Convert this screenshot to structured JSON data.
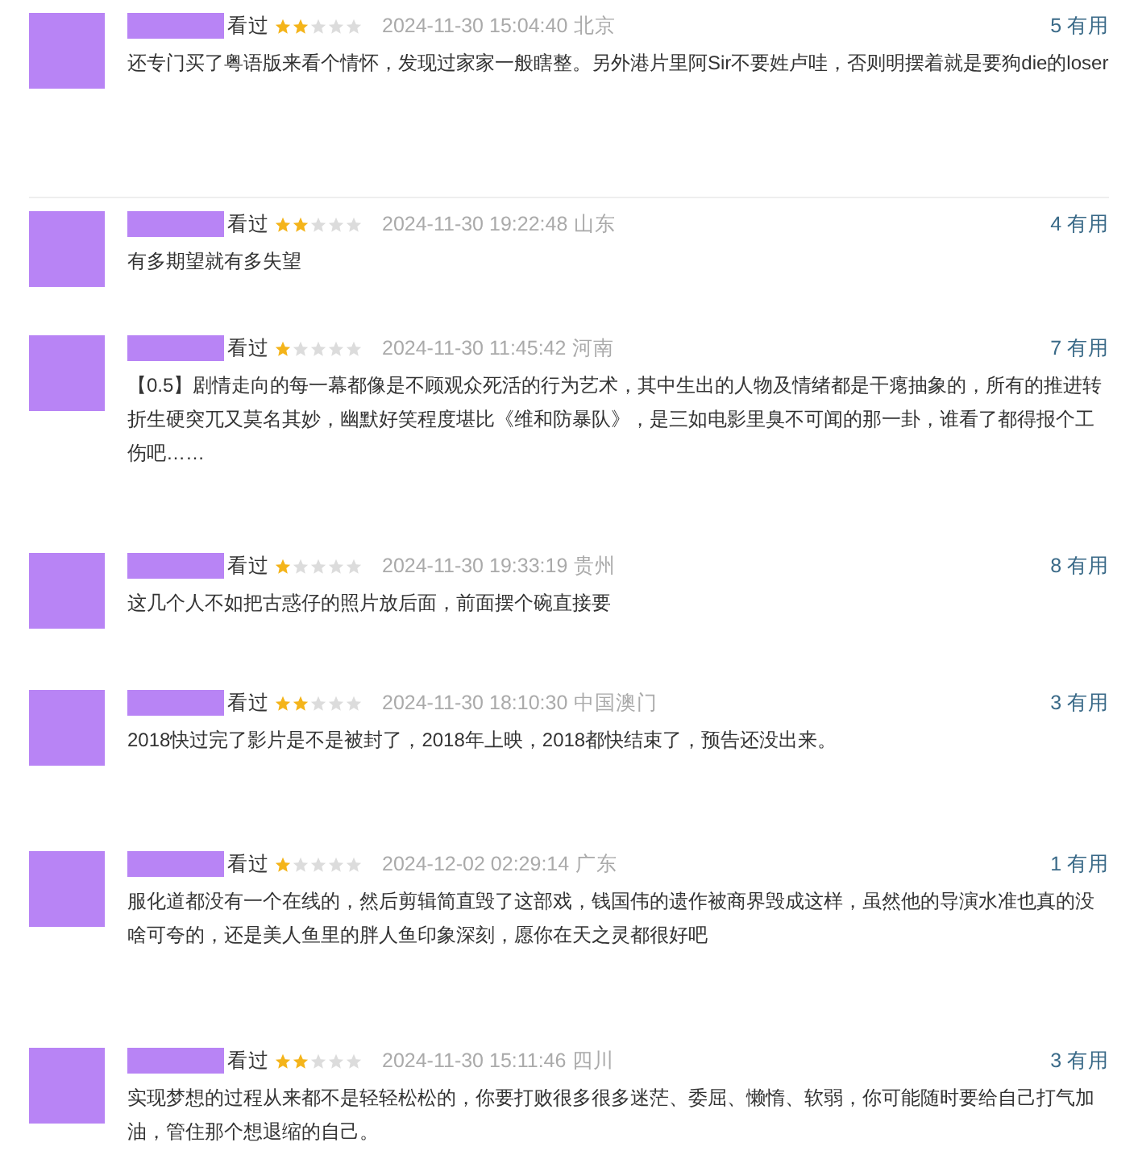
{
  "reviews": [
    {
      "status": "看过",
      "stars": 2,
      "time": "2024-11-30 15:04:40",
      "location": "北京",
      "votes": "5 有用",
      "content": "还专门买了粤语版来看个情怀，发现过家家一般瞎整。另外港片里阿Sir不要姓卢哇，否则明摆着就是要狗die的loser",
      "separated": true
    },
    {
      "status": "看过",
      "stars": 2,
      "time": "2024-11-30 19:22:48",
      "location": "山东",
      "votes": "4 有用",
      "content": "有多期望就有多失望",
      "separated": false
    },
    {
      "status": "看过",
      "stars": 1,
      "time": "2024-11-30 11:45:42",
      "location": "河南",
      "votes": "7 有用",
      "content": "【0.5】剧情走向的每一幕都像是不顾观众死活的行为艺术，其中生出的人物及情绪都是干瘪抽象的，所有的推进转折生硬突兀又莫名其妙，幽默好笑程度堪比《维和防暴队》，是三如电影里臭不可闻的那一卦，谁看了都得报个工伤吧……",
      "separated": false
    },
    {
      "status": "看过",
      "stars": 1,
      "time": "2024-11-30 19:33:19",
      "location": "贵州",
      "votes": "8 有用",
      "content": "这几个人不如把古惑仔的照片放后面，前面摆个碗直接要",
      "separated": false
    },
    {
      "status": "看过",
      "stars": 2,
      "time": "2024-11-30 18:10:30",
      "location": "中国澳门",
      "votes": "3 有用",
      "content": "2018快过完了影片是不是被封了，2018年上映，2018都快结束了，预告还没出来。",
      "separated": false
    },
    {
      "status": "看过",
      "stars": 1,
      "time": "2024-12-02 02:29:14",
      "location": "广东",
      "votes": "1 有用",
      "content": "服化道都没有一个在线的，然后剪辑简直毁了这部戏，钱国伟的遗作被商界毁成这样，虽然他的导演水准也真的没啥可夸的，还是美人鱼里的胖人鱼印象深刻，愿你在天之灵都很好吧",
      "separated": false
    },
    {
      "status": "看过",
      "stars": 2,
      "time": "2024-11-30 15:11:46",
      "location": "四川",
      "votes": "3 有用",
      "content": "实现梦想的过程从来都不是轻轻松松的，你要打败很多很多迷茫、委屈、懒惰、软弱，你可能随时要给自己打气加油，管住那个想退缩的自己。",
      "separated": false
    }
  ]
}
